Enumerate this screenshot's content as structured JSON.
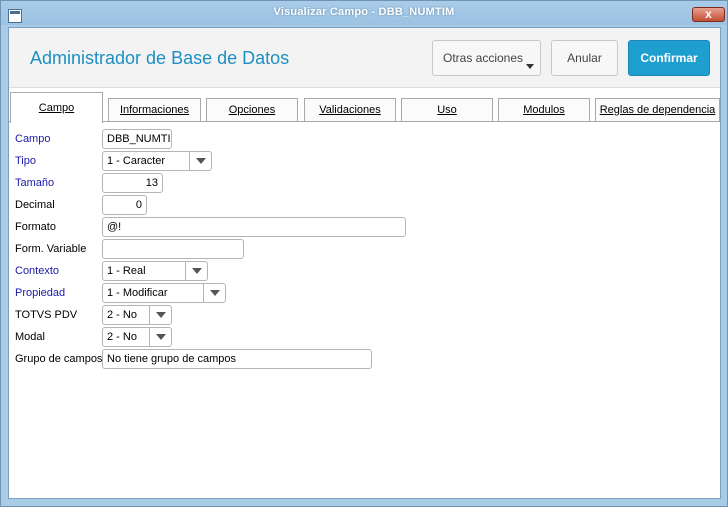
{
  "window": {
    "title": "Visualizar Campo - DBB_NUMTIM",
    "close_label": "x"
  },
  "header": {
    "title": "Administrador de Base de Datos",
    "otras_label": "Otras acciones",
    "anular_label": "Anular",
    "confirmar_label": "Confirmar"
  },
  "tabs": [
    "Campo",
    "Informaciones",
    "Opciones",
    "Validaciones",
    "Uso",
    "Modulos",
    "Reglas de dependencia"
  ],
  "fields": {
    "campo": {
      "label": "Campo",
      "value": "DBB_NUMTIM"
    },
    "tipo": {
      "label": "Tipo",
      "value": "1 - Caracter"
    },
    "tamano": {
      "label": "Tamaño",
      "value": "13"
    },
    "decimal": {
      "label": "Decimal",
      "value": "0"
    },
    "formato": {
      "label": "Formato",
      "value": "@!"
    },
    "form_variable": {
      "label": "Form. Variable",
      "value": ""
    },
    "contexto": {
      "label": "Contexto",
      "value": "1 - Real"
    },
    "propiedad": {
      "label": "Propiedad",
      "value": "1 - Modificar"
    },
    "totvs_pdv": {
      "label": "TOTVS PDV",
      "value": "2 - No"
    },
    "modal": {
      "label": "Modal",
      "value": "2 - No"
    },
    "grupo": {
      "label": "Grupo de campos",
      "value": "No tiene grupo de campos"
    }
  }
}
